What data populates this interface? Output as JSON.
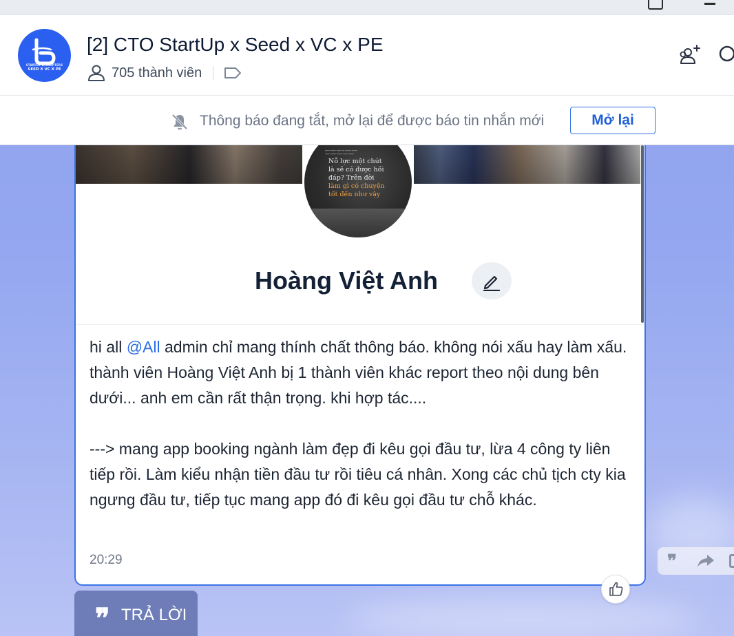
{
  "header": {
    "group_title": "[2] CTO StartUp x Seed x VC x PE",
    "member_count": "705 thành viên",
    "avatar_text_line1": "STARTUP DISRUPTERS",
    "avatar_text_line2": "SEED X VC X PE"
  },
  "notice": {
    "text": "Thông báo đang tắt, mở lại để được báo tin nhắn mới",
    "button_label": "Mở lại"
  },
  "profile_card": {
    "name": "Hoàng Việt Anh",
    "avatar_quote_line1": "Nỗ lực một chút",
    "avatar_quote_line2": "là sẽ có được hồi",
    "avatar_quote_line3": "đáp? Trên đời",
    "avatar_quote_line4": "làm gì có chuyện",
    "avatar_quote_line5": "tốt đến như vậy"
  },
  "message": {
    "prefix": "hi all ",
    "mention": "@All",
    "text_part1": " admin chỉ mang thính chất thông báo. không nói xấu hay làm xấu. thành viên Hoàng Việt Anh bị 1 thành viên khác report theo nội dung bên dưới... anh em cần rất thận trọng. khi hợp tác....",
    "text_part2": "---> mang app booking ngành làm đẹp đi kêu gọi đầu tư, lừa 4 công ty liên tiếp rồi. Làm kiểu nhận tiền đầu tư rồi tiêu cá nhân. Xong các chủ tịch cty kia ngưng đầu tư, tiếp tục mang app đó đi kêu gọi đầu tư chỗ khác.",
    "time": "20:29"
  },
  "actions": {
    "reply_label": "TRẢ LỜI",
    "quote_glyph": "❞"
  },
  "icons": {
    "group_avatar": "group-logo-icon",
    "members": "person-icon",
    "tag": "tag-icon",
    "add_member": "add-member-icon",
    "search": "search-icon",
    "notification_off": "bell-off-icon",
    "edit": "pencil-icon",
    "like": "thumbs-up-icon",
    "forward": "forward-icon"
  },
  "colors": {
    "accent": "#2f6fe3",
    "mention": "#2c6de6",
    "background": "#94a7f0",
    "reply_button": "#6e7db8"
  }
}
